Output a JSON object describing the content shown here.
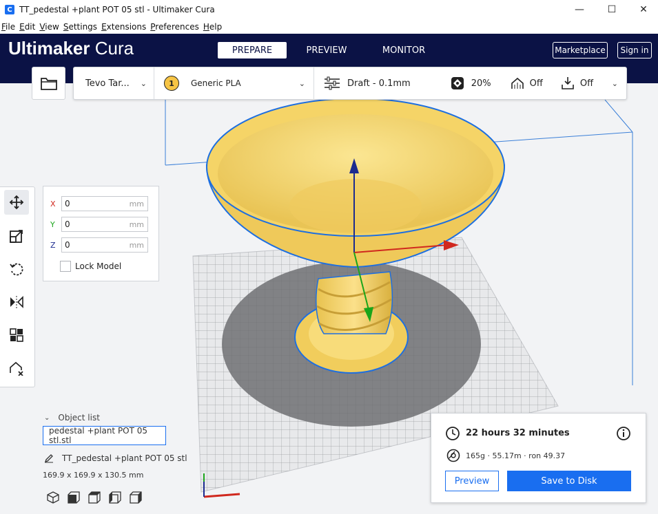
{
  "window": {
    "title": "TT_pedestal +plant POT 05 stl - Ultimaker Cura",
    "app_icon": "C",
    "minimize": "—",
    "maximize": "☐",
    "close": "✕"
  },
  "menu": {
    "items": [
      {
        "u": "F",
        "rest": "ile"
      },
      {
        "u": "E",
        "rest": "dit"
      },
      {
        "u": "V",
        "rest": "iew"
      },
      {
        "u": "S",
        "rest": "ettings"
      },
      {
        "u": "E",
        "rest": "xtensions"
      },
      {
        "u": "P",
        "rest": "references"
      },
      {
        "u": "H",
        "rest": "elp"
      }
    ]
  },
  "header": {
    "logo_bold": "Ultimaker",
    "logo_light": "Cura",
    "tabs": [
      "PREPARE",
      "PREVIEW",
      "MONITOR"
    ],
    "marketplace": "Marketplace",
    "sign_in": "Sign in"
  },
  "printbar": {
    "printer": "Tevo Tar...",
    "extruder_number": "1",
    "material": "Generic PLA",
    "profile": "Draft - 0.1mm",
    "infill": "20%",
    "support": "Off",
    "adhesion": "Off"
  },
  "move_panel": {
    "x_label": "X",
    "x_value": "0",
    "y_label": "Y",
    "y_value": "0",
    "z_label": "Z",
    "z_value": "0",
    "unit": "mm",
    "lock_label": "Lock Model"
  },
  "object_list": {
    "header": "Object list",
    "file": "pedestal +plant POT 05 stl.stl",
    "object_name": "TT_pedestal +plant POT 05 stl",
    "dimensions": "169.9 x 169.9 x 130.5 mm"
  },
  "print_panel": {
    "time": "22 hours 32 minutes",
    "material": "165g · 55.17m · ron 49.37",
    "preview": "Preview",
    "save": "Save to Disk"
  },
  "colors": {
    "header_bg": "#0b1245",
    "accent": "#196ef0",
    "model": "#f5d86a",
    "x_axis": "#d0281e",
    "y_axis": "#1aa51a",
    "z_axis": "#1b2a8f"
  }
}
